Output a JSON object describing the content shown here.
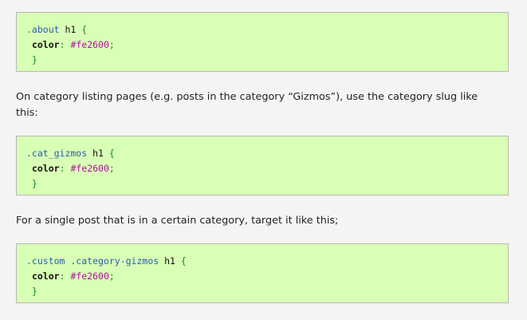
{
  "blocks": [
    {
      "selector": ".about",
      "element": "h1",
      "open": "{",
      "property": "color",
      "colon": ":",
      "value": "#fe2600",
      "semicolon": ";",
      "close": "}"
    },
    {
      "selector": ".cat_gizmos",
      "element": "h1",
      "open": "{",
      "property": "color",
      "colon": ":",
      "value": "#fe2600",
      "semicolon": ";",
      "close": "}"
    },
    {
      "selector": ".custom .category-gizmos",
      "element": "h1",
      "open": "{",
      "property": "color",
      "colon": ":",
      "value": "#fe2600",
      "semicolon": ";",
      "close": "}"
    }
  ],
  "paragraphs": [
    "On category listing pages (e.g. posts in the category “Gizmos”), use the category slug like this:",
    "For a single post that is in a certain category, target it like this;"
  ]
}
